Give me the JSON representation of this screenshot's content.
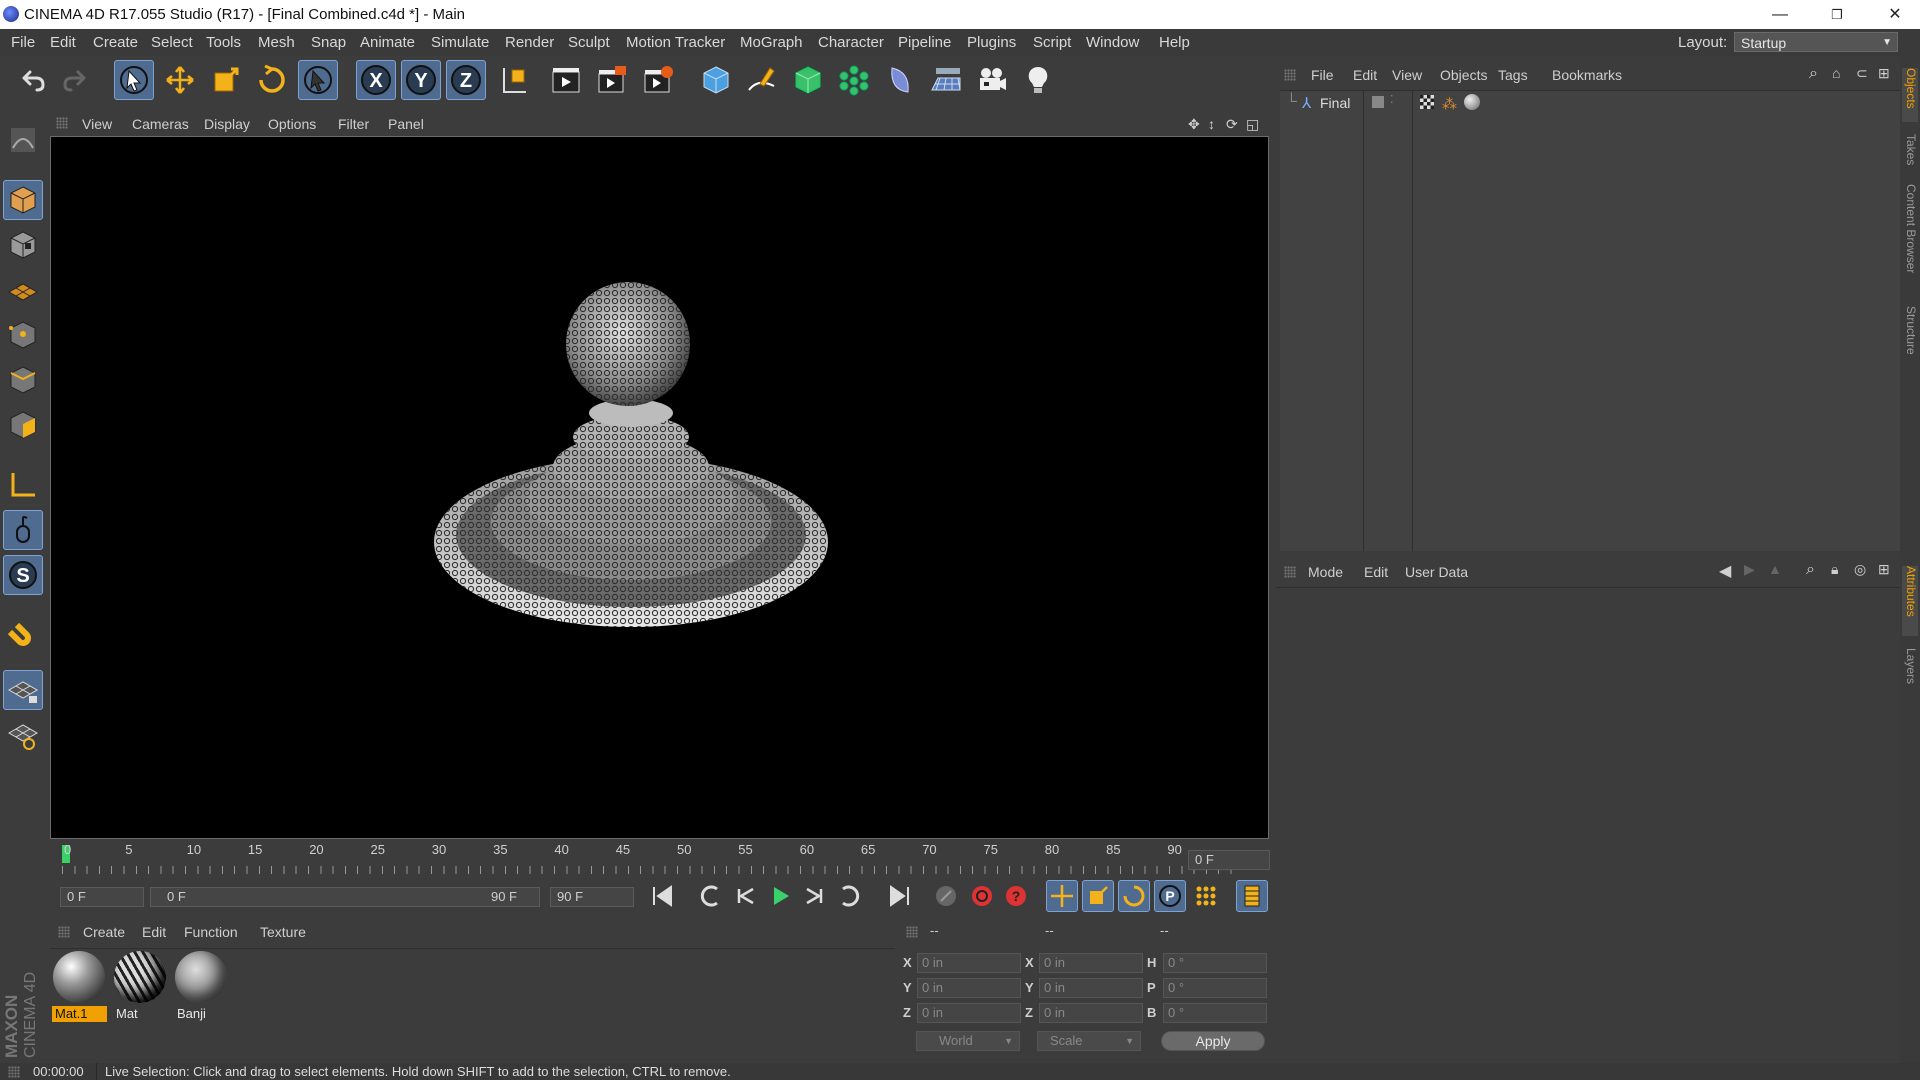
{
  "titlebar": {
    "title": "CINEMA 4D R17.055 Studio (R17) - [Final Combined.c4d *] - Main",
    "minimize": "—",
    "restore": "❐",
    "close": "✕"
  },
  "menubar": {
    "items": [
      "File",
      "Edit",
      "Create",
      "Select",
      "Tools",
      "Mesh",
      "Snap",
      "Animate",
      "Simulate",
      "Render",
      "Sculpt",
      "Motion Tracker",
      "MoGraph",
      "Character",
      "Pipeline",
      "Plugins",
      "Script",
      "Window",
      "Help"
    ],
    "layout_label": "Layout:",
    "layout_value": "Startup"
  },
  "toolbar": {
    "icons": [
      "undo-icon",
      "redo-icon",
      "live-selection-icon",
      "move-icon",
      "scale-icon",
      "rotate-icon",
      "recent-tool-icon",
      "x-axis-lock-icon",
      "y-axis-lock-icon",
      "z-axis-lock-icon",
      "coordinate-system-icon",
      "render-view-icon",
      "render-to-picture-viewer-icon",
      "edit-render-settings-icon",
      "cube-primitive-icon",
      "pen-spline-icon",
      "subdivision-surface-icon",
      "cloner-icon",
      "deformer-icon",
      "floor-environment-icon",
      "camera-icon",
      "light-icon"
    ]
  },
  "left_toolbar": {
    "icons": [
      "make-editable-icon",
      "model-mode-icon",
      "texture-mode-icon",
      "workplane-mode-icon",
      "points-mode-icon",
      "edges-mode-icon",
      "polygons-mode-icon",
      "axis-mode-icon",
      "tweak-mode-icon",
      "solo-mode-icon",
      "magnet-icon",
      "snap-icon",
      "workplane-lock-icon"
    ]
  },
  "viewport": {
    "menu": [
      "View",
      "Cameras",
      "Display",
      "Options",
      "Filter",
      "Panel"
    ]
  },
  "timeline": {
    "ticks": [
      "0",
      "5",
      "10",
      "15",
      "20",
      "25",
      "30",
      "35",
      "40",
      "45",
      "50",
      "55",
      "60",
      "65",
      "70",
      "75",
      "80",
      "85",
      "90"
    ],
    "current_frame": "0 F",
    "start_field": "0 F",
    "range_start": "0 F",
    "range_end": "90 F",
    "end_field": "90 F"
  },
  "material_manager": {
    "menu": [
      "Create",
      "Edit",
      "Function",
      "Texture"
    ],
    "materials": [
      {
        "name": "Mat.1",
        "selected": true
      },
      {
        "name": "Mat",
        "selected": false
      },
      {
        "name": "Banji",
        "selected": false
      }
    ],
    "brand_top": "MAXON",
    "brand_bottom": "CINEMA 4D"
  },
  "coordinates": {
    "headers": [
      "--",
      "--",
      "--"
    ],
    "rows": [
      {
        "l1": "X",
        "v1": "0 in",
        "l2": "X",
        "v2": "0 in",
        "l3": "H",
        "v3": "0 °"
      },
      {
        "l1": "Y",
        "v1": "0 in",
        "l2": "Y",
        "v2": "0 in",
        "l3": "P",
        "v3": "0 °"
      },
      {
        "l1": "Z",
        "v1": "0 in",
        "l2": "Z",
        "v2": "0 in",
        "l3": "B",
        "v3": "0 °"
      }
    ],
    "space": "World",
    "mode": "Scale",
    "apply": "Apply"
  },
  "object_manager": {
    "menu": [
      "File",
      "Edit",
      "View",
      "Objects",
      "Tags",
      "Bookmarks"
    ],
    "object_name": "Final"
  },
  "attribute_manager": {
    "menu": [
      "Mode",
      "Edit",
      "User Data"
    ]
  },
  "side_tabs": {
    "top": [
      "Objects",
      "Takes",
      "Content Browser",
      "Structure"
    ],
    "bottom": [
      "Attributes",
      "Layers"
    ]
  },
  "status": {
    "time": "00:00:00",
    "message": "Live Selection: Click and drag to select elements. Hold down SHIFT to add to the selection, CTRL to remove."
  },
  "colors": {
    "accent": "#4f6b8f",
    "selection": "#f0a000",
    "timeline_marker": "#3ad06a"
  }
}
